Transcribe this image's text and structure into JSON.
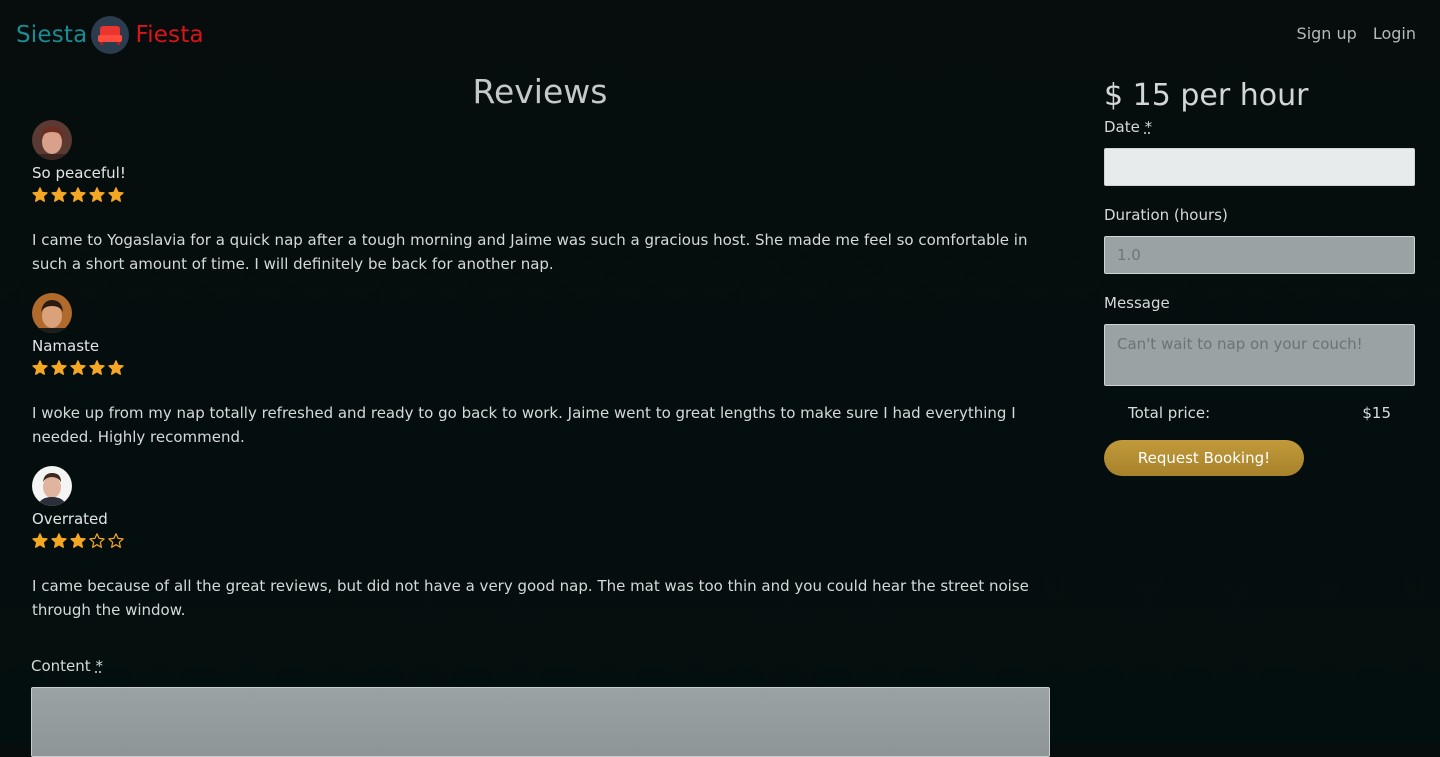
{
  "brand": {
    "left": "Siesta",
    "right": "Fiesta",
    "logo_icon": "sofa-icon"
  },
  "nav": {
    "signup": "Sign up",
    "login": "Login"
  },
  "reviews": {
    "heading": "Reviews",
    "items": [
      {
        "title": "So peaceful!",
        "rating": 5,
        "body": "I came to Yogaslavia for a quick nap after a tough morning and Jaime was such a gracious host. She made me feel so comfortable in such a short amount of time. I will definitely be back for another nap."
      },
      {
        "title": "Namaste",
        "rating": 5,
        "body": "I woke up from my nap totally refreshed and ready to go back to work. Jaime went to great lengths to make sure I had everything I needed. Highly recommend."
      },
      {
        "title": "Overrated",
        "rating": 3,
        "body": "I came because of all the great reviews, but did not have a very good nap. The mat was too thin and you could hear the street noise through the window."
      }
    ],
    "content_label": "Content",
    "required_mark": "*"
  },
  "booking": {
    "price": "$ 15 per hour",
    "date_label": "Date",
    "required_mark": "*",
    "date_value": "",
    "duration_label": "Duration (hours)",
    "duration_placeholder": "1.0",
    "message_label": "Message",
    "message_placeholder": "Can't wait to nap on your couch!",
    "total_label": "Total price:",
    "total_value": "$15",
    "button_label": "Request Booking!"
  },
  "colors": {
    "star": "#f5a623",
    "brand_teal": "#1a8c92",
    "brand_red": "#d9141b",
    "button_gold": "#b08b30"
  }
}
